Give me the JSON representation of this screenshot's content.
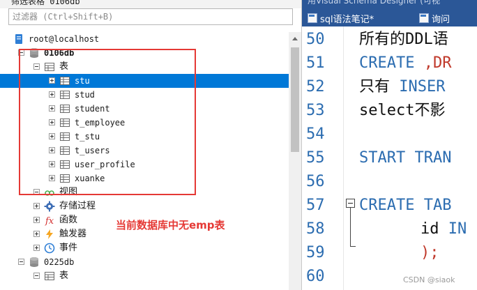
{
  "left": {
    "top_title": "筛选表格 0106db",
    "filter_placeholder": "过滤器 (Ctrl+Shift+B)",
    "tree": [
      {
        "label": "root@localhost",
        "icon": "server-icon",
        "expander": "none",
        "level": 0,
        "bold": false,
        "selected": false
      },
      {
        "label": "0106db",
        "icon": "database-icon",
        "expander": "minus",
        "level": 1,
        "bold": true,
        "selected": false
      },
      {
        "label": "表",
        "icon": "table-folder-icon",
        "expander": "minus",
        "level": 2,
        "bold": false,
        "selected": false
      },
      {
        "label": "stu",
        "icon": "table-icon",
        "expander": "plus",
        "level": 3,
        "bold": false,
        "selected": true
      },
      {
        "label": "stud",
        "icon": "table-icon",
        "expander": "plus",
        "level": 3,
        "bold": false,
        "selected": false
      },
      {
        "label": "student",
        "icon": "table-icon",
        "expander": "plus",
        "level": 3,
        "bold": false,
        "selected": false
      },
      {
        "label": "t_employee",
        "icon": "table-icon",
        "expander": "plus",
        "level": 3,
        "bold": false,
        "selected": false
      },
      {
        "label": "t_stu",
        "icon": "table-icon",
        "expander": "plus",
        "level": 3,
        "bold": false,
        "selected": false
      },
      {
        "label": "t_users",
        "icon": "table-icon",
        "expander": "plus",
        "level": 3,
        "bold": false,
        "selected": false
      },
      {
        "label": "user_profile",
        "icon": "table-icon",
        "expander": "plus",
        "level": 3,
        "bold": false,
        "selected": false
      },
      {
        "label": "xuanke",
        "icon": "table-icon",
        "expander": "plus",
        "level": 3,
        "bold": false,
        "selected": false
      },
      {
        "label": "视图",
        "icon": "view-icon",
        "expander": "minus",
        "level": 2,
        "bold": false,
        "selected": false
      },
      {
        "label": "存储过程",
        "icon": "gear-icon",
        "expander": "plus",
        "level": 2,
        "bold": false,
        "selected": false
      },
      {
        "label": "函数",
        "icon": "function-icon",
        "expander": "plus",
        "level": 2,
        "bold": false,
        "selected": false
      },
      {
        "label": "触发器",
        "icon": "lightning-icon",
        "expander": "plus",
        "level": 2,
        "bold": false,
        "selected": false
      },
      {
        "label": "事件",
        "icon": "clock-icon",
        "expander": "plus",
        "level": 2,
        "bold": false,
        "selected": false
      },
      {
        "label": "0225db",
        "icon": "database-icon",
        "expander": "minus",
        "level": 1,
        "bold": false,
        "selected": false
      },
      {
        "label": "表",
        "icon": "table-folder-icon",
        "expander": "minus",
        "level": 2,
        "bold": false,
        "selected": false
      }
    ],
    "annotation_text": "当前数据库中无emp表",
    "annotation_color": "#e53935"
  },
  "right": {
    "prev_tab_title": "用Visual Schema Designer (可视",
    "tabs": [
      {
        "label": "sql语法笔记*"
      },
      {
        "label": "询问"
      }
    ],
    "tab_bar_color": "#2b5797",
    "line_numbers": [
      "50",
      "51",
      "52",
      "53",
      "54",
      "55",
      "56",
      "57",
      "58",
      "59",
      "60"
    ],
    "code": {
      "l50": "所有的DDL语",
      "l51_kw": "CREATE",
      "l51_rest": " ,DR",
      "l52_text": "只有 ",
      "l52_kw": "INSER",
      "l53": "select不影",
      "l55_kw": "START TRAN",
      "l57_kw": "CREATE TAB",
      "l58_text": "id ",
      "l58_kw": "IN",
      "l59": ");"
    },
    "keyword_color": "#2b6cb0"
  },
  "watermark": "CSDN @siaok"
}
